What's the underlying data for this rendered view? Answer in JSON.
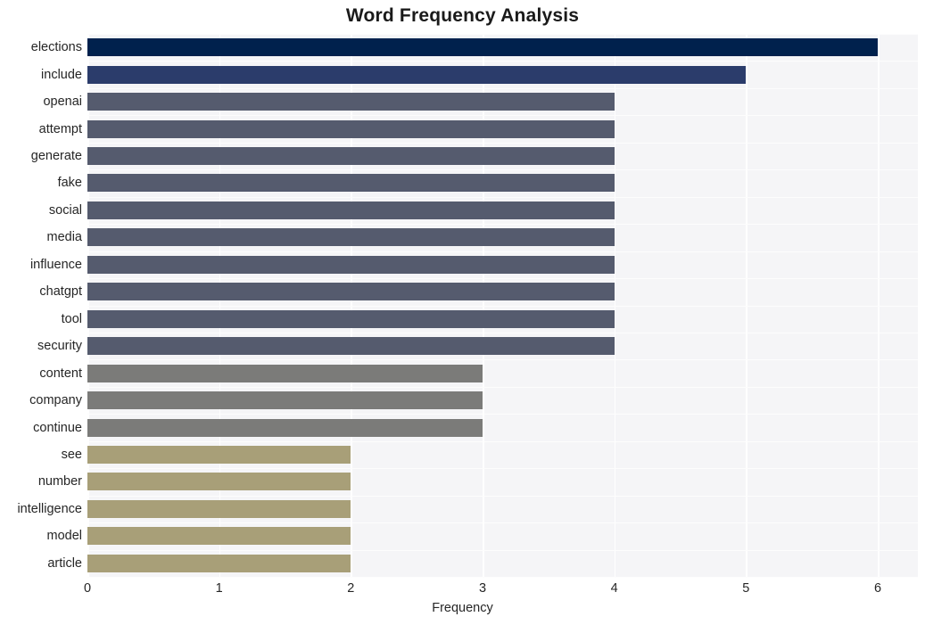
{
  "chart_data": {
    "type": "bar",
    "orientation": "horizontal",
    "title": "Word Frequency Analysis",
    "xlabel": "Frequency",
    "ylabel": "",
    "xlim": [
      0,
      6
    ],
    "xticks": [
      0,
      1,
      2,
      3,
      4,
      5,
      6
    ],
    "xtick_labels": [
      "0",
      "1",
      "2",
      "3",
      "4",
      "5",
      "6"
    ],
    "grid": true,
    "legend": false,
    "categories": [
      "elections",
      "include",
      "openai",
      "attempt",
      "generate",
      "fake",
      "social",
      "media",
      "influence",
      "chatgpt",
      "tool",
      "security",
      "content",
      "company",
      "continue",
      "see",
      "number",
      "intelligence",
      "model",
      "article"
    ],
    "values": [
      6,
      5,
      4,
      4,
      4,
      4,
      4,
      4,
      4,
      4,
      4,
      4,
      3,
      3,
      3,
      2,
      2,
      2,
      2,
      2
    ],
    "bar_colors": [
      "#00214d",
      "#2b3c6b",
      "#555b6e",
      "#555b6e",
      "#555b6e",
      "#555b6e",
      "#555b6e",
      "#555b6e",
      "#555b6e",
      "#555b6e",
      "#555b6e",
      "#555b6e",
      "#7b7b79",
      "#7b7b79",
      "#7b7b79",
      "#a89f78",
      "#a89f78",
      "#a89f78",
      "#a89f78",
      "#a89f78"
    ]
  },
  "style": {
    "plot_background": "#f5f5f7",
    "figure_background": "#ffffff",
    "gridline_color": "#ffffff",
    "text_color": "#262626",
    "title_color": "#1a1a1a"
  }
}
